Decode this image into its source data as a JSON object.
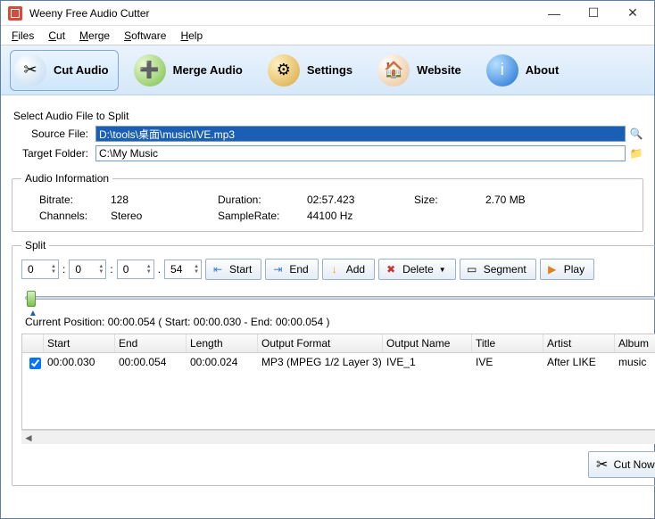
{
  "window": {
    "title": "Weeny Free Audio Cutter"
  },
  "menu": {
    "files": "Files",
    "cut": "Cut",
    "merge": "Merge",
    "software": "Software",
    "help": "Help"
  },
  "toolbar": {
    "cut": "Cut Audio",
    "merge": "Merge Audio",
    "settings": "Settings",
    "website": "Website",
    "about": "About"
  },
  "labels": {
    "select_file": "Select Audio File to Split",
    "source_file": "Source File:",
    "target_folder": "Target Folder:",
    "audio_info": "Audio Information",
    "bitrate": "Bitrate:",
    "channels": "Channels:",
    "duration": "Duration:",
    "samplerate": "SampleRate:",
    "size": "Size:",
    "split": "Split",
    "current_pos": "Current Position: 00:00.054 ( Start: 00:00.030 - End: 00:00.054 )"
  },
  "values": {
    "source_file": "D:\\tools\\桌面\\music\\IVE.mp3",
    "target_folder": "C:\\My Music",
    "bitrate": "128",
    "channels": "Stereo",
    "duration": "02:57.423",
    "samplerate": "44100 Hz",
    "size": "2.70 MB",
    "spin_h": "0",
    "spin_m": "0",
    "spin_s": "0",
    "spin_ms": "54"
  },
  "buttons": {
    "start": "Start",
    "end": "End",
    "add": "Add",
    "delete": "Delete",
    "segment": "Segment",
    "play": "Play",
    "cut_now": "Cut Now!"
  },
  "grid": {
    "headers": {
      "start": "Start",
      "end": "End",
      "length": "Length",
      "format": "Output Format",
      "name": "Output Name",
      "title": "Title",
      "artist": "Artist",
      "album": "Album"
    },
    "rows": [
      {
        "checked": true,
        "start": "00:00.030",
        "end": "00:00.054",
        "length": "00:00.024",
        "format": "MP3 (MPEG 1/2 Layer 3)",
        "name": "IVE_1",
        "title": "IVE",
        "artist": "After LIKE",
        "album": "music"
      }
    ]
  }
}
